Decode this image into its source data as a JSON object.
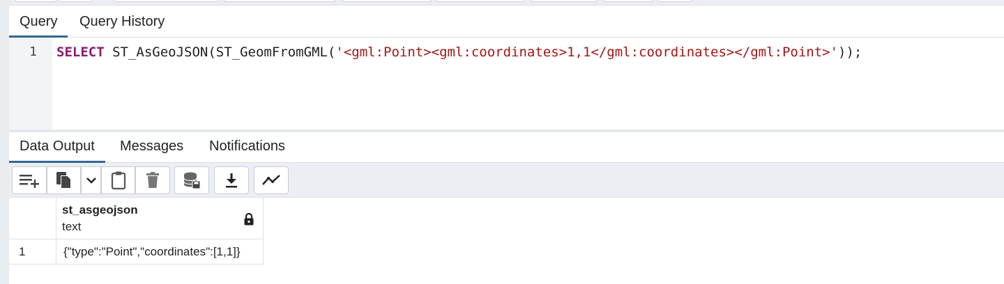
{
  "query_tabs": [
    {
      "label": "Query",
      "active": true
    },
    {
      "label": "Query History",
      "active": false
    }
  ],
  "editor": {
    "line_number": "1",
    "keyword": "SELECT",
    "code_before_string": " ST_AsGeoJSON(ST_GeomFromGML(",
    "string_literal": "'<gml:Point><gml:coordinates>1,1</gml:coordinates></gml:Point>'",
    "code_after_string": "));"
  },
  "output_tabs": [
    {
      "label": "Data Output",
      "active": true
    },
    {
      "label": "Messages",
      "active": false
    },
    {
      "label": "Notifications",
      "active": false
    }
  ],
  "toolbar_icons": [
    "add-row-icon",
    "copy-icon",
    "chevron-down-icon",
    "paste-icon",
    "delete-icon",
    "save-data-icon",
    "download-icon",
    "graph-visualiser-icon"
  ],
  "grid": {
    "column": {
      "name": "st_asgeojson",
      "type": "text",
      "icon": "lock-icon"
    },
    "rows": [
      {
        "num": "1",
        "value": "{\"type\":\"Point\",\"coordinates\":[1,1]}"
      }
    ]
  },
  "colors": {
    "accent": "#326690",
    "keyword": "#8a1a74",
    "string": "#a31515"
  }
}
